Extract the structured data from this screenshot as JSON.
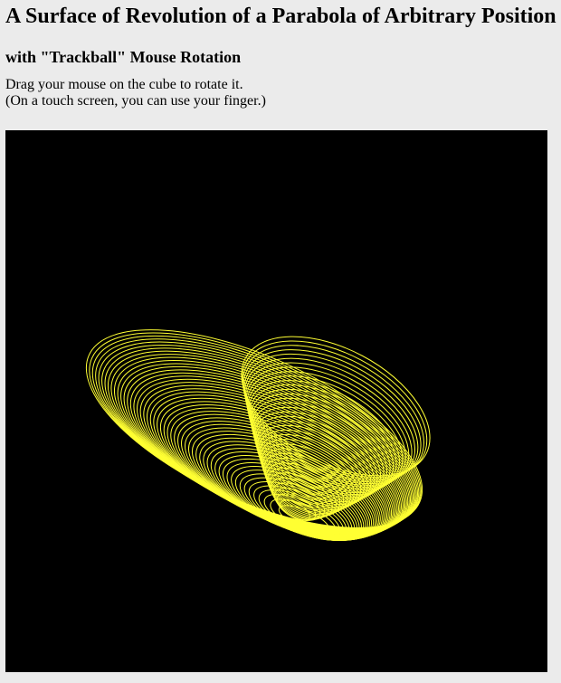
{
  "page": {
    "title": "A Surface of Revolution of a Parabola of Arbitrary Position",
    "subtitle": "with \"Trackball\" Mouse Rotation",
    "instruction_line1": "Drag your mouse on the cube to rotate it.",
    "instruction_line2": "(On a touch screen, you can use your finger.)"
  },
  "canvas": {
    "background_color": "#000000",
    "stroke_color": "#ffff33"
  }
}
